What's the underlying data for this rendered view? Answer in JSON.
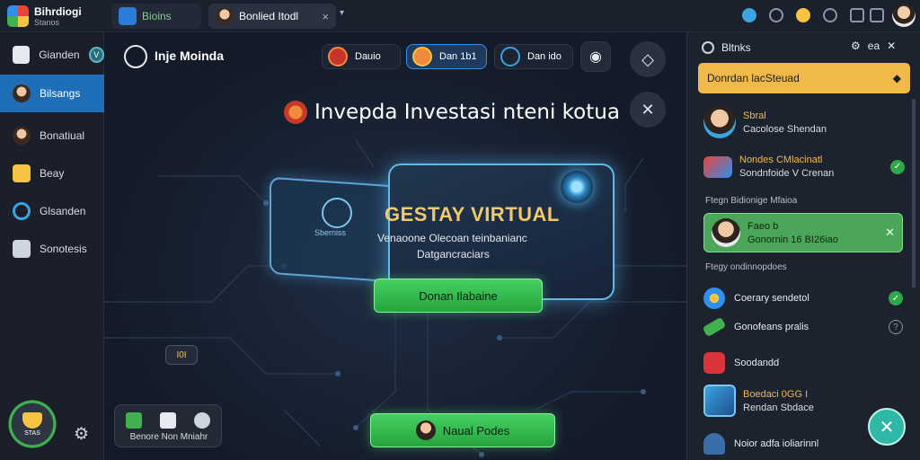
{
  "topbar": {
    "brand_name": "Bihrdiogi",
    "brand_sub": "Stanos",
    "tabs": [
      {
        "label": "Bioins"
      },
      {
        "label": "Bonlied Itodl"
      }
    ],
    "tab_close": "×",
    "tab_more": "▾"
  },
  "sidebar": {
    "items": [
      {
        "label": "Gianden",
        "badge": "V"
      },
      {
        "label": "Bilsangs"
      },
      {
        "label": "Bonatiual"
      },
      {
        "label": "Beay"
      },
      {
        "label": "Glsanden"
      },
      {
        "label": "Sonotesis"
      }
    ],
    "trophy_label": "STAS"
  },
  "stage": {
    "app_title": "Inje Moinda",
    "pills": [
      {
        "label": "Dauio"
      },
      {
        "label": "Dan 1b1"
      },
      {
        "label": "Dan ido"
      }
    ],
    "headline": "Invepda Investasi nteni kotua",
    "card": {
      "label": "Sberniss",
      "title": "GESTAY VIRTUAL",
      "line1": "Venaoone Olecoan teinbanianc",
      "line2": "Datgancraciars"
    },
    "primary_button": "Donan Ilabaine",
    "float_badge": "I0I",
    "dock_label": "Benore Non Mniahr",
    "bottom_button": "Naual Podes"
  },
  "panel": {
    "title": "Bltnks",
    "actions_label": "ea",
    "banner": "Donrdan lacSteuad",
    "notifications": [
      {
        "title": "Sbral",
        "sub": "Cacolose Shendan"
      },
      {
        "title": "Nondes CMlacinatl",
        "sub": "Sondnfoide V Crenan"
      }
    ],
    "section1": "Ftegn Bidionige Mfaioa",
    "highlight": {
      "title": "Faeo b",
      "sub": "Gonornin 16 BI26iao"
    },
    "section2": "Ftegy ondinnopdoes",
    "rows": [
      {
        "label": "Coerary sendetol"
      },
      {
        "label": "Gonofeans pralis"
      },
      {
        "label": "Soodandd"
      }
    ],
    "bottom_item": {
      "title": "Boedaci 0GG I",
      "sub": "Rendan Sbdace"
    },
    "last_item": "Noior adfa ioliarinnl"
  },
  "colors": {
    "accent_blue": "#1e6fb8",
    "accent_green": "#3fb24f",
    "banner_yellow": "#f1b94a",
    "fab_teal": "#2fb8a6"
  },
  "icons": [
    "brand-logo-icon",
    "tab-app-icon",
    "avatar-icon",
    "telegram-icon",
    "gear-icon",
    "close-icon",
    "camera-icon",
    "trophy-icon",
    "checkmark-icon",
    "info-icon",
    "shield-icon"
  ]
}
